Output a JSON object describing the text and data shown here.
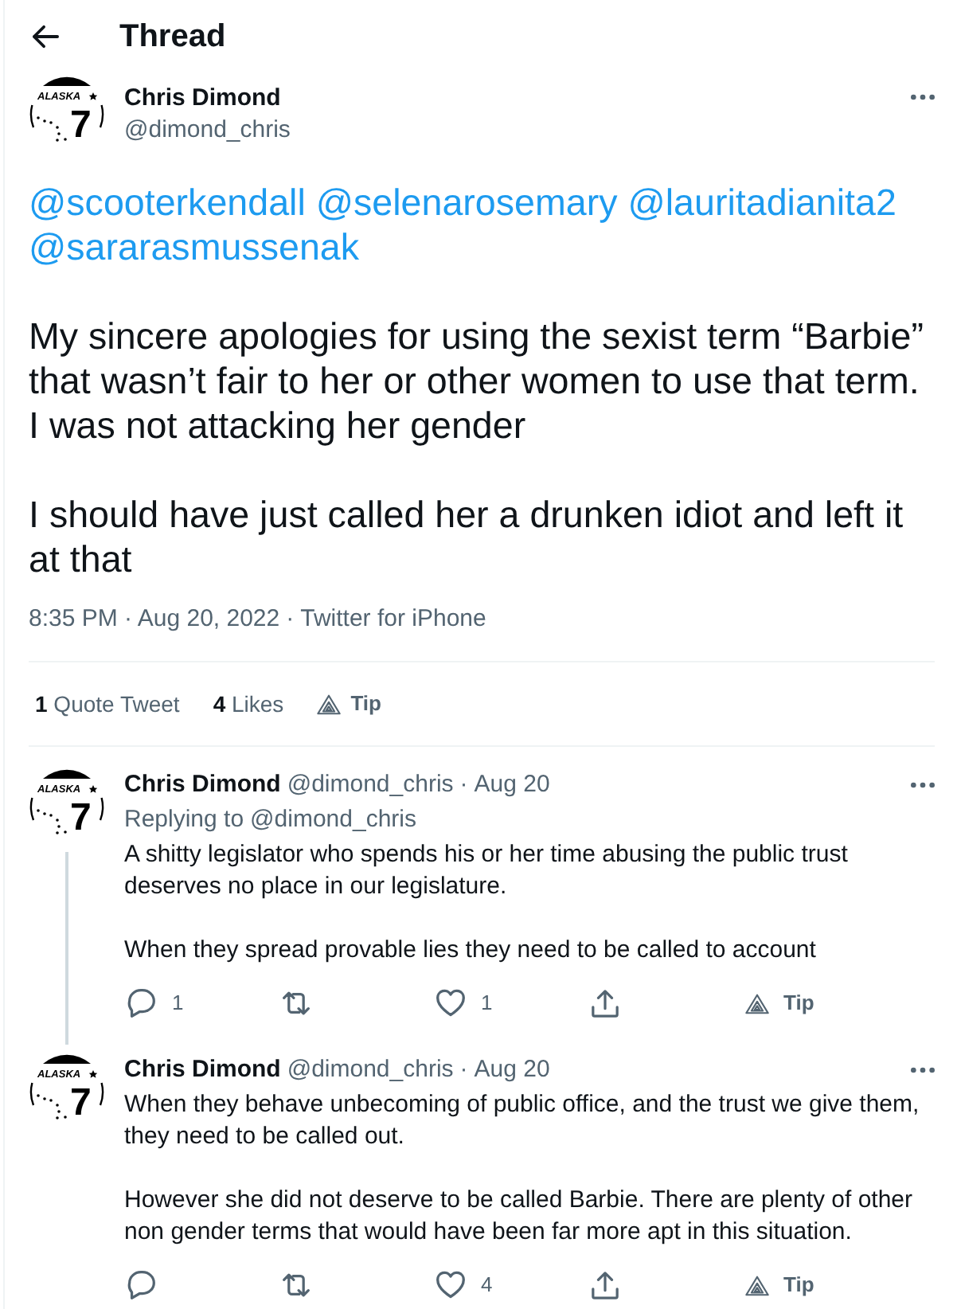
{
  "header": {
    "title": "Thread"
  },
  "main_tweet": {
    "avatar": {
      "caption": "ALASKA",
      "number": "7"
    },
    "name": "Chris Dimond",
    "handle": "@dimond_chris",
    "mentions": [
      "@scooterkendall",
      "@selenarosemary",
      "@lauritadianita2",
      "@sararasmussenak"
    ],
    "paragraphs": [
      "My sincere apologies for using the sexist term “Barbie” that wasn’t fair to her or other women to use that term.\nI was not attacking her gender",
      "I should have just called her a drunken idiot and left it at that"
    ],
    "meta": {
      "timestamp": "8:35 PM · Aug 20, 2022",
      "separator": "·",
      "source": "Twitter for iPhone"
    },
    "stats": [
      {
        "count": "1",
        "label": "Quote Tweet"
      },
      {
        "count": "4",
        "label": "Likes"
      }
    ],
    "tip": {
      "label": "Tip"
    }
  },
  "replies": [
    {
      "avatar": {
        "caption": "ALASKA",
        "number": "7"
      },
      "name": "Chris Dimond",
      "handle": "@dimond_chris",
      "separator": "·",
      "date": "Aug 20",
      "replying_to": {
        "label": "Replying to",
        "handle": "@dimond_chris"
      },
      "paragraphs": [
        "A shitty legislator who spends his or her time abusing the public trust deserves no place in our legislature.",
        "When they spread provable lies they need to be called to account"
      ],
      "actions": [
        {
          "kind": "reply",
          "count": "1"
        },
        {
          "kind": "retweet"
        },
        {
          "kind": "like",
          "count": "1"
        },
        {
          "kind": "share"
        },
        {
          "kind": "tip",
          "label": "Tip"
        }
      ],
      "thread_continues": true
    },
    {
      "avatar": {
        "caption": "ALASKA",
        "number": "7"
      },
      "name": "Chris Dimond",
      "handle": "@dimond_chris",
      "separator": "·",
      "date": "Aug 20",
      "paragraphs": [
        "When they behave unbecoming of public office, and the trust we give them, they need to be called out.",
        "However she did not deserve to be called Barbie. There are plenty of other non gender terms that would have been far more apt in this situation."
      ],
      "actions": [
        {
          "kind": "reply"
        },
        {
          "kind": "retweet"
        },
        {
          "kind": "like",
          "count": "4"
        },
        {
          "kind": "share"
        },
        {
          "kind": "tip",
          "label": "Tip"
        }
      ],
      "thread_continues": false
    }
  ]
}
